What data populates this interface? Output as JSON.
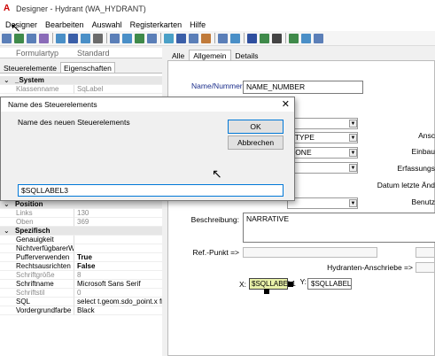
{
  "window": {
    "title": "Designer - Hydrant (WA_HYDRANT)",
    "app_icon": "A"
  },
  "menu": [
    "Designer",
    "Bearbeiten",
    "Auswahl",
    "Registerkarten",
    "Hilfe"
  ],
  "toolbar": {
    "icons": [
      {
        "name": "grid-icon",
        "color": "#5b7fb8"
      },
      {
        "name": "grid-icon",
        "color": "#3f8a4a"
      },
      {
        "name": "grid-icon",
        "color": "#5b7fb8"
      },
      {
        "name": "grid-icon",
        "color": "#8a6bb8"
      },
      {
        "name": "sep"
      },
      {
        "name": "layout-icon",
        "color": "#4a8fc7"
      },
      {
        "name": "layout-icon",
        "color": "#3b5fa8"
      },
      {
        "name": "layout-icon",
        "color": "#4a8fc7"
      },
      {
        "name": "layout-icon",
        "color": "#6b6b6b"
      },
      {
        "name": "sep"
      },
      {
        "name": "align-icon",
        "color": "#5b7fb8"
      },
      {
        "name": "align-icon",
        "color": "#4a8fc7"
      },
      {
        "name": "align-icon",
        "color": "#3f8a4a"
      },
      {
        "name": "align-icon",
        "color": "#5b7fb8"
      },
      {
        "name": "sep"
      },
      {
        "name": "picture-icon",
        "color": "#4aa0c7"
      },
      {
        "name": "field-icon",
        "color": "#3b5fa8"
      },
      {
        "name": "combo-icon",
        "color": "#5b7fb8"
      },
      {
        "name": "list-icon",
        "color": "#c07a3a"
      },
      {
        "name": "sep"
      },
      {
        "name": "button-icon",
        "color": "#5b7fb8"
      },
      {
        "name": "button-icon",
        "color": "#4a8fc7"
      },
      {
        "name": "sep"
      },
      {
        "name": "label-icon",
        "color": "#2f4f9f"
      },
      {
        "name": "image-icon",
        "color": "#3f8a4a"
      },
      {
        "name": "line-icon",
        "color": "#444444"
      },
      {
        "name": "sep"
      },
      {
        "name": "checkbox-icon",
        "color": "#3f8a4a"
      },
      {
        "name": "grid-icon",
        "color": "#4a8fc7"
      },
      {
        "name": "tab-icon",
        "color": "#5b7fb8"
      }
    ]
  },
  "header": {
    "key": "Formulartyp",
    "value": "Standard"
  },
  "left_tabs": [
    "Steuerelemente",
    "Eigenschaften"
  ],
  "properties_top": [
    {
      "type": "cat",
      "key": "_System",
      "value": ""
    },
    {
      "type": "grey",
      "key": "Klassenname",
      "value": "SqLabel"
    }
  ],
  "properties_bottom": [
    {
      "type": "cat",
      "key": "Position",
      "value": ""
    },
    {
      "type": "grey",
      "key": "Links",
      "value": "130"
    },
    {
      "type": "grey",
      "key": "Oben",
      "value": "369"
    },
    {
      "type": "cat",
      "key": "Spezifisch",
      "value": ""
    },
    {
      "type": "normal",
      "key": "Genauigkeit",
      "value": ""
    },
    {
      "type": "normal",
      "key": "NichtverfügbarerWe",
      "value": ""
    },
    {
      "type": "bold",
      "key": "Pufferverwenden",
      "value": "True"
    },
    {
      "type": "bold",
      "key": "Rechtsausrichten",
      "value": "False"
    },
    {
      "type": "grey",
      "key": "Schriftgröße",
      "value": "8"
    },
    {
      "type": "normal",
      "key": "Schriftname",
      "value": "Microsoft Sans Serif"
    },
    {
      "type": "grey",
      "key": "Schriftstil",
      "value": "0"
    },
    {
      "type": "normal",
      "key": "SQL",
      "value": "select t.geom.sdo_point.x from"
    },
    {
      "type": "normal",
      "key": "Vordergrundfarbe",
      "value": "Black"
    }
  ],
  "right_tabs": [
    "Alle",
    "Allgemein",
    "Details"
  ],
  "form": {
    "name_label": "Name/Nummer:",
    "name_value": "NAME_NUMBER",
    "combo_type": "_TYPE",
    "combo_zone": "ZONE",
    "combo_last": "",
    "right_labels": [
      "Ansc",
      "Einbau",
      "Erfassungs",
      "Datum letzte Änd",
      "Benutz"
    ],
    "beschreibung_label": "Beschreibung:",
    "beschreibung_value": "NARRATIVE",
    "refpunkt_label": "Ref.-Punkt =>",
    "anschriebe_label": "Hydranten-Anschriebe =>",
    "x_label": "X:",
    "x_value": "$SQLLABEL1",
    "y_label": "Y:",
    "y_value": "$SQLLABEL2"
  },
  "dialog": {
    "title": "Name des Steuerelements",
    "prompt": "Name des neuen Steuerelements",
    "ok": "OK",
    "cancel": "Abbrechen",
    "input_value": "$SQLLABEL3",
    "close": "✕"
  }
}
